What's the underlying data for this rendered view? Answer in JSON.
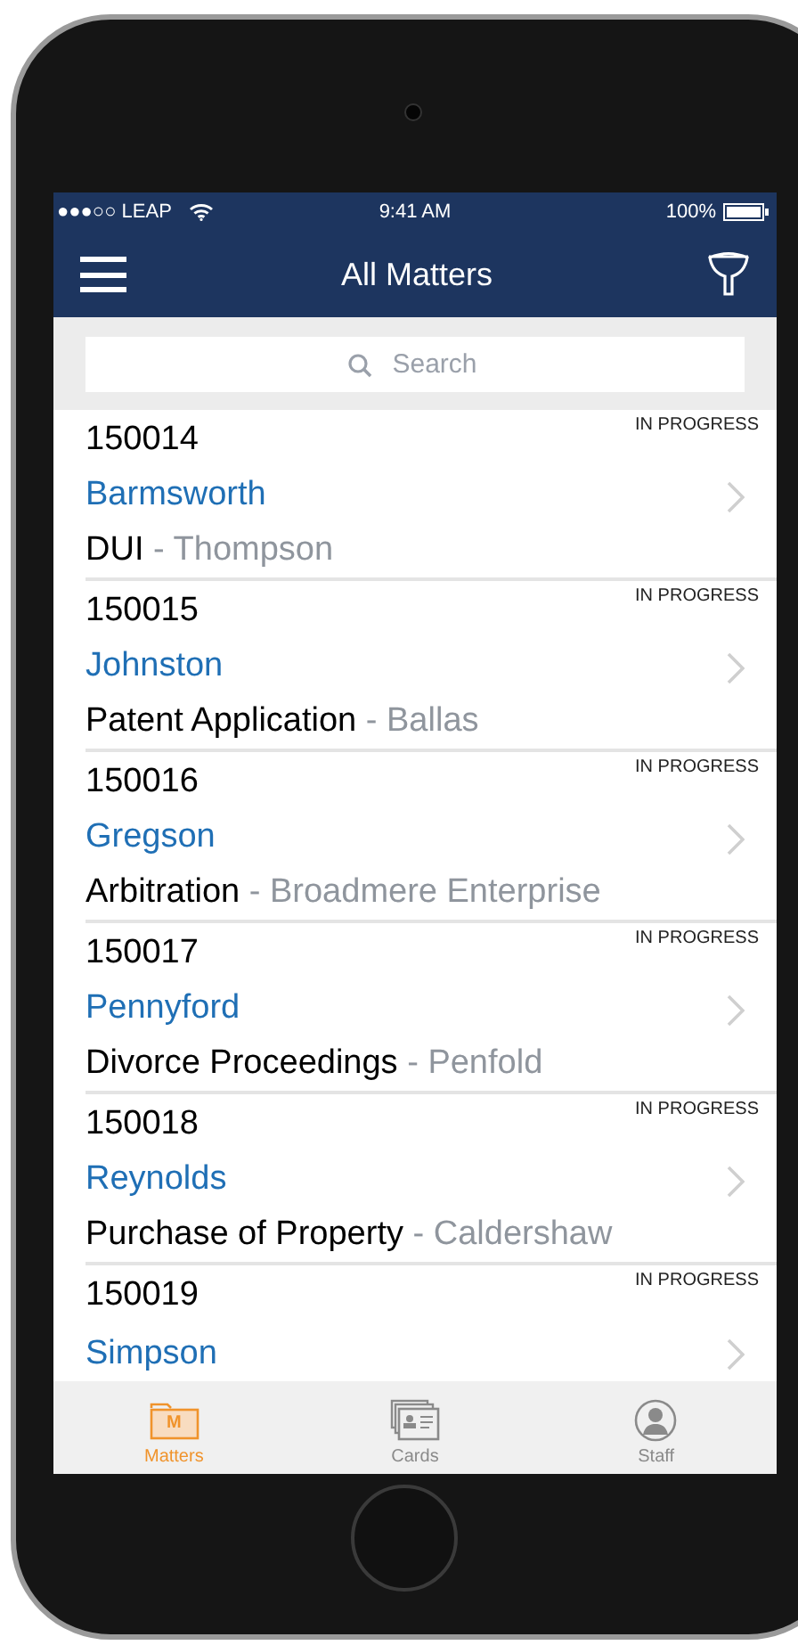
{
  "status_bar": {
    "carrier": "●●●○○ LEAP",
    "time": "9:41 AM",
    "battery": "100%"
  },
  "nav": {
    "title": "All Matters"
  },
  "search": {
    "placeholder": "Search"
  },
  "matters": [
    {
      "number": "150014",
      "status": "IN PROGRESS",
      "client": "Barmsworth",
      "matter_type": "DUI",
      "other_party": "- Thompson"
    },
    {
      "number": "150015",
      "status": "IN PROGRESS",
      "client": "Johnston",
      "matter_type": "Patent Application",
      "other_party": "- Ballas"
    },
    {
      "number": "150016",
      "status": "IN PROGRESS",
      "client": "Gregson",
      "matter_type": "Arbitration",
      "other_party": "- Broadmere Enterprise"
    },
    {
      "number": "150017",
      "status": "IN PROGRESS",
      "client": "Pennyford",
      "matter_type": "Divorce Proceedings",
      "other_party": "- Penfold"
    },
    {
      "number": "150018",
      "status": "IN PROGRESS",
      "client": "Reynolds",
      "matter_type": "Purchase of Property",
      "other_party": "- Caldershaw"
    },
    {
      "number": "150019",
      "status": "IN PROGRESS",
      "client": "Simpson"
    }
  ],
  "tab_bar": [
    {
      "kind": "matters",
      "label": "Matters",
      "icon_letter": "M",
      "selected": true
    },
    {
      "kind": "cards",
      "label": "Cards",
      "selected": false
    },
    {
      "kind": "staff",
      "label": "Staff",
      "selected": false
    }
  ]
}
